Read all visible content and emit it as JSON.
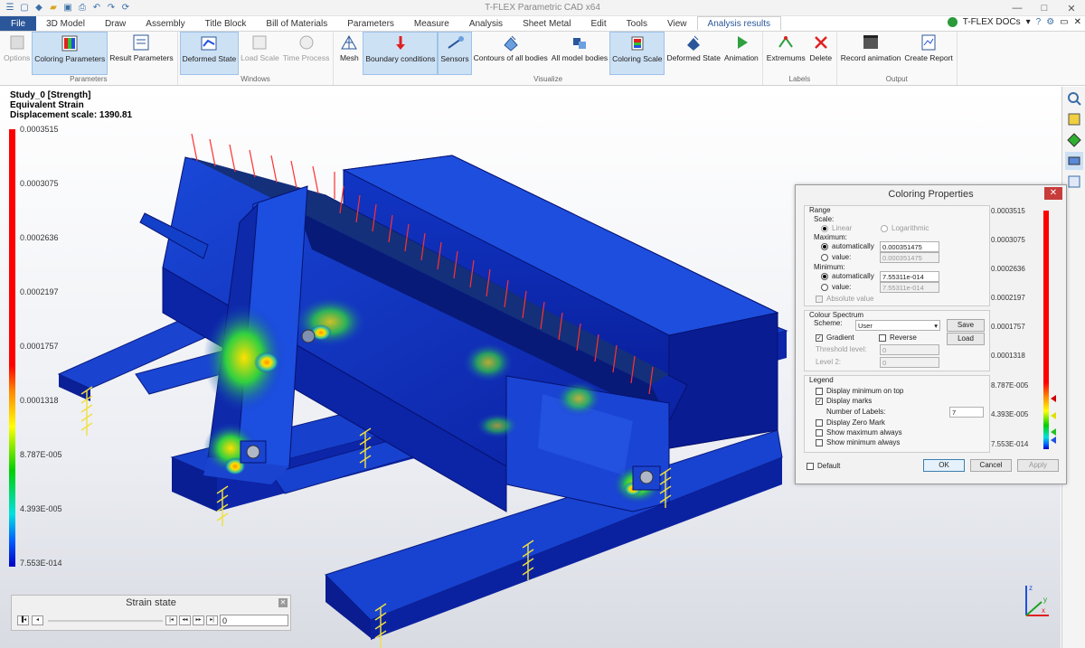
{
  "window": {
    "title": "T-FLEX Parametric CAD x64",
    "docs_label": "T-FLEX DOCs"
  },
  "tabs": [
    "File",
    "3D Model",
    "Draw",
    "Assembly",
    "Title Block",
    "Bill of Materials",
    "Parameters",
    "Measure",
    "Analysis",
    "Sheet Metal",
    "Edit",
    "Tools",
    "View",
    "Analysis results"
  ],
  "active_tab": "Analysis results",
  "ribbon": {
    "groups": [
      {
        "label": "Parameters",
        "buttons": [
          {
            "label": "Options",
            "icon": "options-icon",
            "disabled": true
          },
          {
            "label": "Coloring Parameters",
            "icon": "coloring-parameters-icon",
            "selected": true
          },
          {
            "label": "Result Parameters",
            "icon": "result-parameters-icon"
          }
        ]
      },
      {
        "label": "Windows",
        "buttons": [
          {
            "label": "Deformed State",
            "icon": "deformed-state-icon",
            "selected": true
          },
          {
            "label": "Load Scale",
            "icon": "load-scale-icon",
            "disabled": true
          },
          {
            "label": "Time Process",
            "icon": "time-process-icon",
            "disabled": true
          }
        ]
      },
      {
        "label": "Visualize",
        "buttons": [
          {
            "label": "Mesh",
            "icon": "mesh-icon"
          },
          {
            "label": "Boundary conditions",
            "icon": "boundary-conditions-icon",
            "selected": true
          },
          {
            "label": "Sensors",
            "icon": "sensors-icon",
            "selected": true
          },
          {
            "label": "Contours of all bodies",
            "icon": "contours-icon"
          },
          {
            "label": "All model bodies",
            "icon": "all-model-bodies-icon"
          },
          {
            "label": "Coloring Scale",
            "icon": "coloring-scale-icon",
            "selected": true
          },
          {
            "label": "Deformed State",
            "icon": "deformed-state-3d-icon"
          },
          {
            "label": "Animation",
            "icon": "animation-icon"
          }
        ]
      },
      {
        "label": "Labels",
        "buttons": [
          {
            "label": "Extremums",
            "icon": "extremums-icon"
          },
          {
            "label": "Delete",
            "icon": "delete-icon"
          }
        ]
      },
      {
        "label": "Output",
        "buttons": [
          {
            "label": "Record animation",
            "icon": "record-animation-icon"
          },
          {
            "label": "Create Report",
            "icon": "create-report-icon"
          }
        ]
      }
    ]
  },
  "info": {
    "study": "Study_0 [Strength]",
    "result": "Equivalent Strain",
    "scale": "Displacement scale: 1390.81"
  },
  "legend": {
    "labels": [
      "0.0003515",
      "0.0003075",
      "0.0002636",
      "0.0002197",
      "0.0001757",
      "0.0001318",
      "8.787E-005",
      "4.393E-005",
      "7.553E-014"
    ]
  },
  "strain_panel": {
    "title": "Strain state",
    "value": "0"
  },
  "dialog": {
    "title": "Coloring Properties",
    "range": {
      "title": "Range",
      "scale_label": "Scale:",
      "linear": "Linear",
      "log": "Logarithmic",
      "max_label": "Maximum:",
      "min_label": "Minimum:",
      "auto": "automatically",
      "value": "value:",
      "max_auto": "0.000351475",
      "max_value": "0.000351475",
      "min_auto": "7.55311e-014",
      "min_value": "7.55311e-014",
      "absolute": "Absolute value"
    },
    "spectrum": {
      "title": "Colour Spectrum",
      "scheme_label": "Scheme:",
      "scheme": "User",
      "save": "Save",
      "load": "Load",
      "gradient": "Gradient",
      "reverse": "Reverse",
      "threshold": "Threshold level:",
      "threshold_val": "0",
      "level2": "Level 2:",
      "level2_val": "0"
    },
    "legend": {
      "title": "Legend",
      "min_top": "Display minimum on top",
      "marks": "Display marks",
      "num_labels": "Number of Labels:",
      "num_labels_val": "7",
      "zero": "Display Zero Mark",
      "show_max": "Show maximum always",
      "show_min": "Show minimum always"
    },
    "default": "Default",
    "ok": "OK",
    "cancel": "Cancel",
    "apply": "Apply",
    "scale_labels": [
      "0.0003515",
      "0.0003075",
      "0.0002636",
      "0.0002197",
      "0.0001757",
      "0.0001318",
      "8.787E-005",
      "4.393E-005",
      "7.553E-014"
    ]
  },
  "colors": {
    "accent": "#2b579a",
    "model_blue": "#1238c8"
  }
}
